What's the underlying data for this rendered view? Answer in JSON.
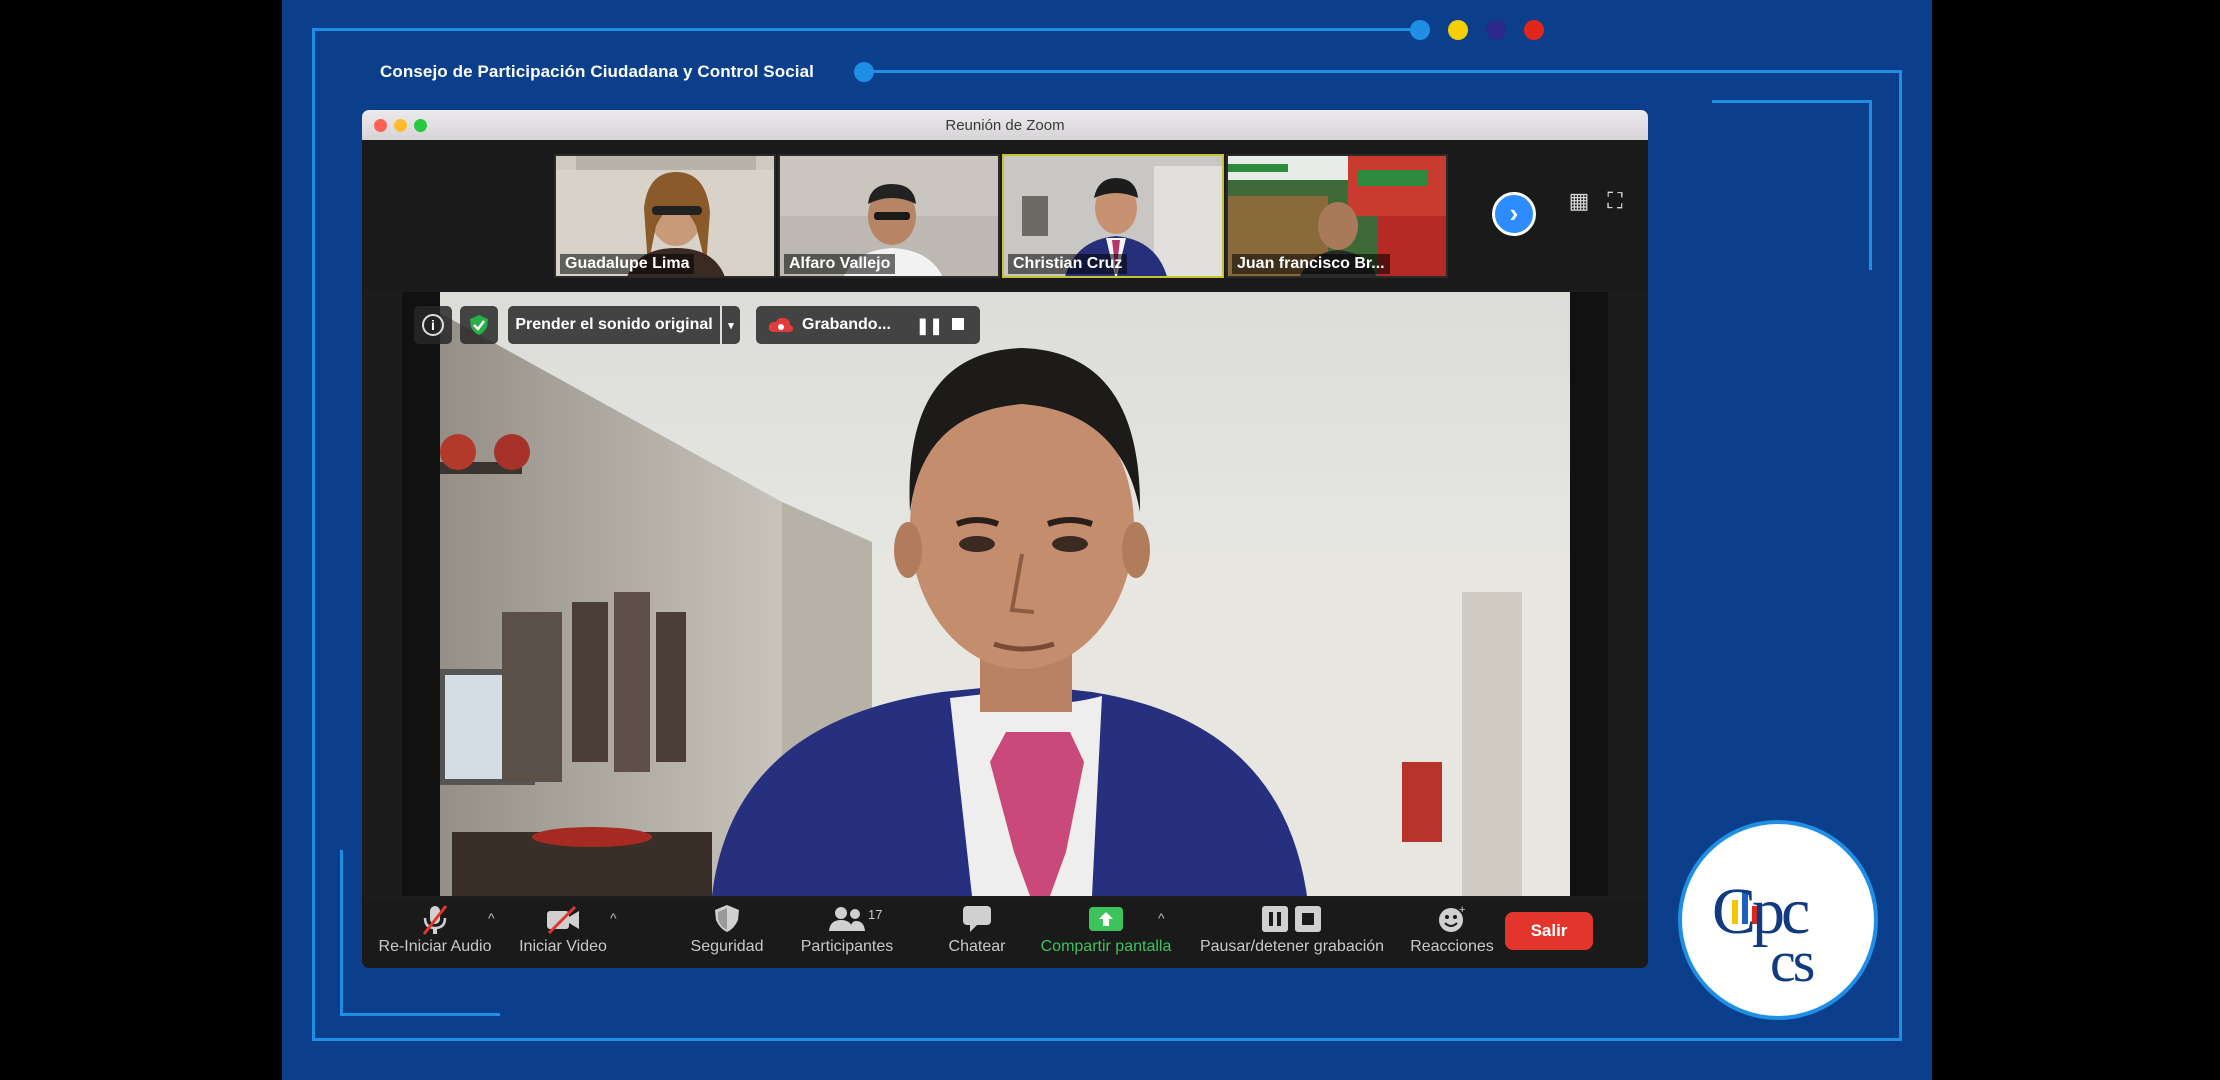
{
  "org_title": "Consejo de Participación Ciudadana y Control Social",
  "window": {
    "title": "Reunión de Zoom"
  },
  "participants": [
    {
      "name": "Guadalupe Lima"
    },
    {
      "name": "Alfaro Vallejo"
    },
    {
      "name": "Christian Cruz"
    },
    {
      "name": "Juan francisco Br..."
    }
  ],
  "overlay": {
    "original_sound_label": "Prender el sonido original",
    "recording_label": "Grabando..."
  },
  "toolbar": {
    "audio_label": "Re-Iniciar Audio",
    "video_label": "Iniciar Video",
    "security_label": "Seguridad",
    "participants_label": "Participantes",
    "participants_count": "17",
    "chat_label": "Chatear",
    "share_label": "Compartir pantalla",
    "record_label": "Pausar/detener grabación",
    "reactions_label": "Reacciones",
    "leave_label": "Salir"
  },
  "logo": {
    "line1": "Cpc",
    "line2": "cs"
  },
  "colors": {
    "background": "#0b3f8c",
    "frame_lines": "#1f8fe6",
    "dot_1": "#1f8fe6",
    "dot_2": "#f5d000",
    "dot_3": "#2b2a8c",
    "dot_4": "#e3261c",
    "zoom_accent": "#2d8cff",
    "leave_button": "#e2362d",
    "share_green": "#3dc25c"
  },
  "icons": {
    "audio": "mic-muted-icon",
    "video": "camera-off-icon",
    "security": "shield-icon",
    "participants": "people-icon",
    "chat": "chat-bubble-icon",
    "share": "share-screen-icon",
    "record": "pause-stop-icon",
    "reactions": "emoji-icon"
  }
}
